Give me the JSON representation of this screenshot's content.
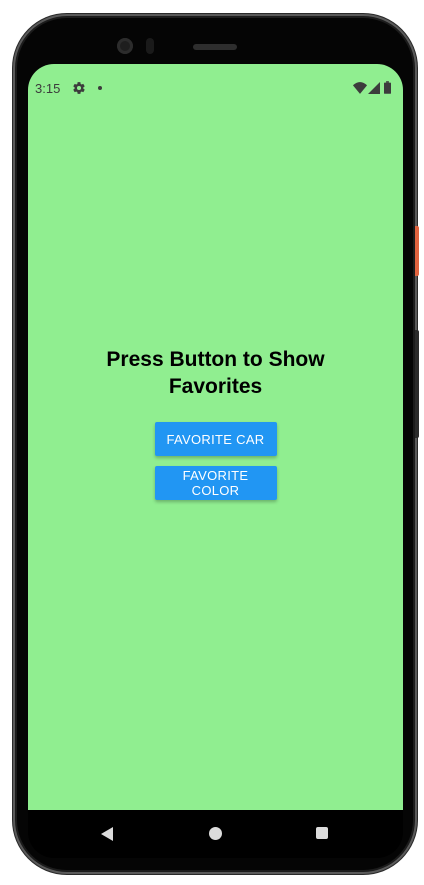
{
  "status_bar": {
    "time": "3:15",
    "icons": [
      "gear-icon",
      "notification-dot-icon",
      "wifi-icon",
      "signal-icon",
      "battery-icon"
    ]
  },
  "main": {
    "title": "Press Button to Show Favorites",
    "buttons": [
      {
        "label": "FAVORITE CAR"
      },
      {
        "label": "FAVORITE COLOR"
      }
    ]
  },
  "nav_bar": {
    "icons": [
      "back-icon",
      "home-icon",
      "recents-icon"
    ]
  },
  "colors": {
    "screen_background": "#90ee90",
    "button_background": "#2196f3",
    "button_text": "#ffffff",
    "title_text": "#000000",
    "status_icons": "#3c3c3c"
  }
}
